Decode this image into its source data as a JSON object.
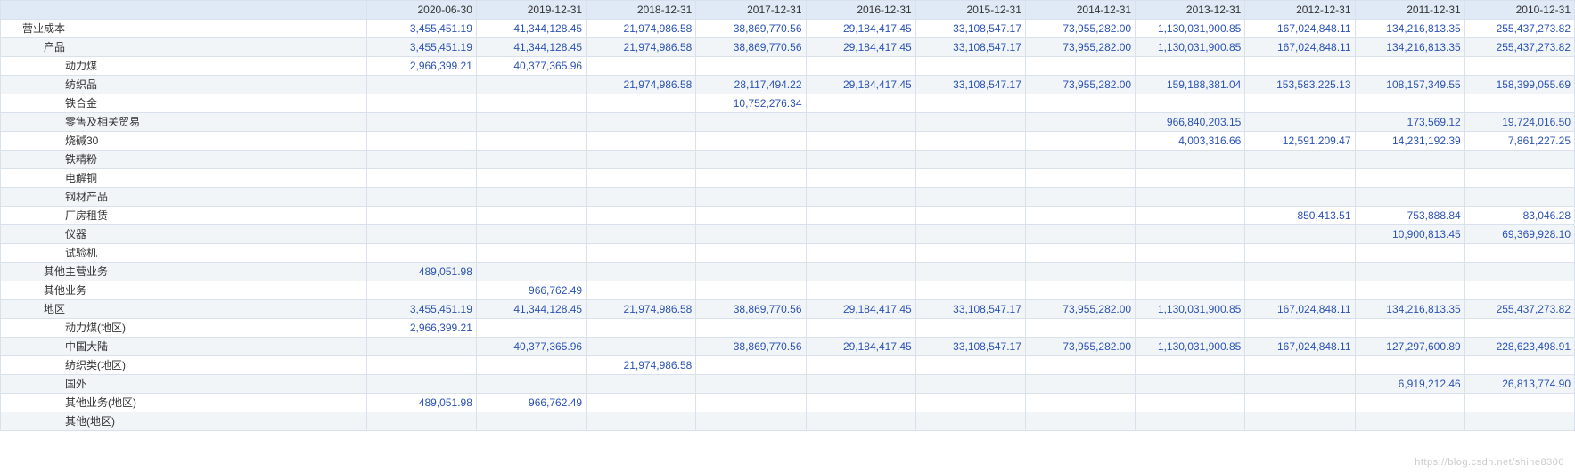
{
  "chart_data": {
    "type": "table",
    "columns": [
      "2020-06-30",
      "2019-12-31",
      "2018-12-31",
      "2017-12-31",
      "2016-12-31",
      "2015-12-31",
      "2014-12-31",
      "2013-12-31",
      "2012-12-31",
      "2011-12-31",
      "2010-12-31"
    ],
    "rows": [
      {
        "label": "营业成本",
        "indent": 1,
        "values": [
          "3,455,451.19",
          "41,344,128.45",
          "21,974,986.58",
          "38,869,770.56",
          "29,184,417.45",
          "33,108,547.17",
          "73,955,282.00",
          "1,130,031,900.85",
          "167,024,848.11",
          "134,216,813.35",
          "255,437,273.82"
        ]
      },
      {
        "label": "产品",
        "indent": 2,
        "values": [
          "3,455,451.19",
          "41,344,128.45",
          "21,974,986.58",
          "38,869,770.56",
          "29,184,417.45",
          "33,108,547.17",
          "73,955,282.00",
          "1,130,031,900.85",
          "167,024,848.11",
          "134,216,813.35",
          "255,437,273.82"
        ]
      },
      {
        "label": "动力煤",
        "indent": 3,
        "values": [
          "2,966,399.21",
          "40,377,365.96",
          "",
          "",
          "",
          "",
          "",
          "",
          "",
          "",
          ""
        ]
      },
      {
        "label": "纺织品",
        "indent": 3,
        "values": [
          "",
          "",
          "21,974,986.58",
          "28,117,494.22",
          "29,184,417.45",
          "33,108,547.17",
          "73,955,282.00",
          "159,188,381.04",
          "153,583,225.13",
          "108,157,349.55",
          "158,399,055.69"
        ]
      },
      {
        "label": "铁合金",
        "indent": 3,
        "values": [
          "",
          "",
          "",
          "10,752,276.34",
          "",
          "",
          "",
          "",
          "",
          "",
          ""
        ]
      },
      {
        "label": "零售及相关贸易",
        "indent": 3,
        "values": [
          "",
          "",
          "",
          "",
          "",
          "",
          "",
          "966,840,203.15",
          "",
          "173,569.12",
          "19,724,016.50"
        ]
      },
      {
        "label": "烧碱30",
        "indent": 3,
        "values": [
          "",
          "",
          "",
          "",
          "",
          "",
          "",
          "4,003,316.66",
          "12,591,209.47",
          "14,231,192.39",
          "7,861,227.25"
        ]
      },
      {
        "label": "铁精粉",
        "indent": 3,
        "values": [
          "",
          "",
          "",
          "",
          "",
          "",
          "",
          "",
          "",
          "",
          ""
        ]
      },
      {
        "label": "电解铜",
        "indent": 3,
        "values": [
          "",
          "",
          "",
          "",
          "",
          "",
          "",
          "",
          "",
          "",
          ""
        ]
      },
      {
        "label": "钢材产品",
        "indent": 3,
        "values": [
          "",
          "",
          "",
          "",
          "",
          "",
          "",
          "",
          "",
          "",
          ""
        ]
      },
      {
        "label": "厂房租赁",
        "indent": 3,
        "values": [
          "",
          "",
          "",
          "",
          "",
          "",
          "",
          "",
          "850,413.51",
          "753,888.84",
          "83,046.28"
        ]
      },
      {
        "label": "仪器",
        "indent": 3,
        "values": [
          "",
          "",
          "",
          "",
          "",
          "",
          "",
          "",
          "",
          "10,900,813.45",
          "69,369,928.10"
        ]
      },
      {
        "label": "试验机",
        "indent": 3,
        "values": [
          "",
          "",
          "",
          "",
          "",
          "",
          "",
          "",
          "",
          "",
          ""
        ]
      },
      {
        "label": "其他主营业务",
        "indent": 2,
        "values": [
          "489,051.98",
          "",
          "",
          "",
          "",
          "",
          "",
          "",
          "",
          "",
          ""
        ]
      },
      {
        "label": "其他业务",
        "indent": 2,
        "values": [
          "",
          "966,762.49",
          "",
          "",
          "",
          "",
          "",
          "",
          "",
          "",
          ""
        ]
      },
      {
        "label": "地区",
        "indent": 2,
        "values": [
          "3,455,451.19",
          "41,344,128.45",
          "21,974,986.58",
          "38,869,770.56",
          "29,184,417.45",
          "33,108,547.17",
          "73,955,282.00",
          "1,130,031,900.85",
          "167,024,848.11",
          "134,216,813.35",
          "255,437,273.82"
        ]
      },
      {
        "label": "动力煤(地区)",
        "indent": 3,
        "values": [
          "2,966,399.21",
          "",
          "",
          "",
          "",
          "",
          "",
          "",
          "",
          "",
          ""
        ]
      },
      {
        "label": "中国大陆",
        "indent": 3,
        "values": [
          "",
          "40,377,365.96",
          "",
          "38,869,770.56",
          "29,184,417.45",
          "33,108,547.17",
          "73,955,282.00",
          "1,130,031,900.85",
          "167,024,848.11",
          "127,297,600.89",
          "228,623,498.91"
        ]
      },
      {
        "label": "纺织类(地区)",
        "indent": 3,
        "values": [
          "",
          "",
          "21,974,986.58",
          "",
          "",
          "",
          "",
          "",
          "",
          "",
          ""
        ]
      },
      {
        "label": "国外",
        "indent": 3,
        "values": [
          "",
          "",
          "",
          "",
          "",
          "",
          "",
          "",
          "",
          "6,919,212.46",
          "26,813,774.90"
        ]
      },
      {
        "label": "其他业务(地区)",
        "indent": 3,
        "values": [
          "489,051.98",
          "966,762.49",
          "",
          "",
          "",
          "",
          "",
          "",
          "",
          "",
          ""
        ]
      },
      {
        "label": "其他(地区)",
        "indent": 3,
        "values": [
          "",
          "",
          "",
          "",
          "",
          "",
          "",
          "",
          "",
          "",
          ""
        ]
      }
    ]
  },
  "watermark": "https://blog.csdn.net/shine8300"
}
